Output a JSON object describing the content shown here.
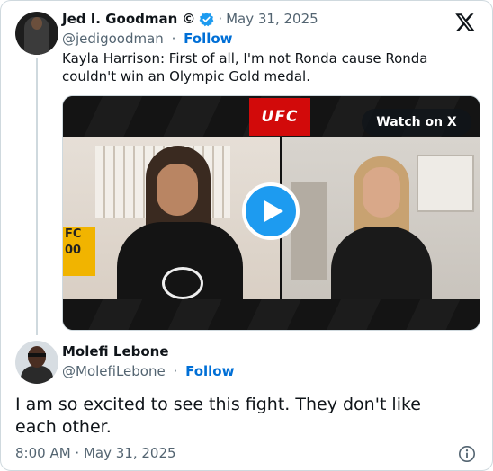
{
  "colors": {
    "accent_blue": "#1d9bf0",
    "follow_blue": "#006fd6",
    "muted_text": "#536471",
    "ufc_red": "#d20a0a"
  },
  "quoted_tweet": {
    "display_name": "Jed I. Goodman",
    "name_suffix": "©",
    "date": "May 31, 2025",
    "handle": "@jedigoodman",
    "follow_label": "Follow",
    "text": "Kayla Harrison: First of all, I'm not Ronda cause Ronda couldn't win an Olympic Gold medal.",
    "icons": {
      "verified": "verified-badge-icon",
      "platform": "x-logo-icon"
    },
    "media": {
      "brand_logo": "UFC",
      "watch_label": "Watch on X",
      "sign_text_line1": "FC",
      "sign_text_line2": "00",
      "play_icon": "play-icon"
    }
  },
  "main_tweet": {
    "display_name": "Molefi Lebone",
    "handle": "@MolefiLebone",
    "follow_label": "Follow",
    "text": "I am so excited to see this fight. They don't like each other.",
    "timestamp": "8:00 AM · May 31, 2025",
    "info_icon": "info-icon"
  }
}
